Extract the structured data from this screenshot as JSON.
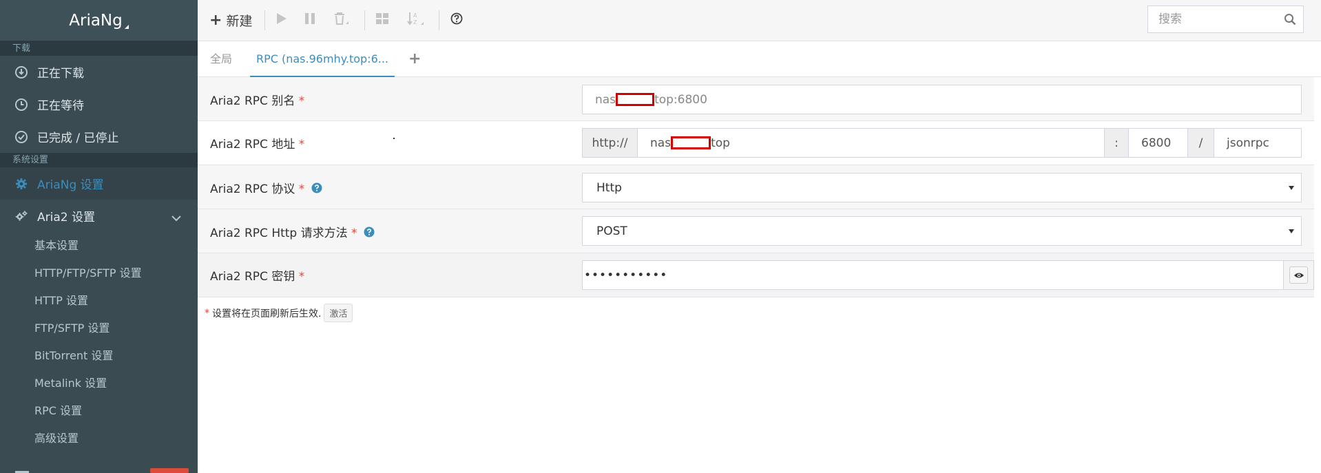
{
  "app": {
    "name": "AriaNg"
  },
  "sidebar": {
    "downloads_header": "下载",
    "downloads": [
      {
        "label": "正在下载",
        "icon": "download-circle-icon"
      },
      {
        "label": "正在等待",
        "icon": "clock-icon"
      },
      {
        "label": "已完成 / 已停止",
        "icon": "check-circle-icon"
      }
    ],
    "settings_header": "系统设置",
    "ariang_settings": "AriaNg 设置",
    "aria2_settings": "Aria2 设置",
    "aria2_subitems": [
      "基本设置",
      "HTTP/FTP/SFTP 设置",
      "HTTP 设置",
      "FTP/SFTP 设置",
      "BitTorrent 设置",
      "Metalink 设置",
      "RPC 设置",
      "高级设置"
    ]
  },
  "toolbar": {
    "new_label": "新建",
    "search_placeholder": "搜索"
  },
  "tabs": {
    "global": "全局",
    "rpc": "RPC (nas.96mhy.top:6..."
  },
  "settings": {
    "alias": {
      "label": "Aria2 RPC 别名",
      "required": "*",
      "value_prefix": "nas",
      "value_suffix": "top:6800"
    },
    "address": {
      "label": "Aria2 RPC 地址",
      "required": "*",
      "protocol": "http://",
      "host_prefix": "nas",
      "host_suffix": "top",
      "colon": ":",
      "port": "6800",
      "slash": "/",
      "interface": "jsonrpc"
    },
    "protocol": {
      "label": "Aria2 RPC 协议",
      "required": "*",
      "value": "Http"
    },
    "http_method": {
      "label": "Aria2 RPC Http 请求方法",
      "required": "*",
      "value": "POST"
    },
    "secret": {
      "label": "Aria2 RPC 密钥",
      "required": "*",
      "value": "•••••••••••"
    }
  },
  "footnote": {
    "asterisk": "*",
    "text": "设置将在页面刷新后生效.",
    "activate": "激活"
  },
  "colors": {
    "sidebar_bg": "#3b4b52",
    "accent": "#3c8dbc",
    "required": "#dd4b39",
    "redaction": "#d40000"
  }
}
